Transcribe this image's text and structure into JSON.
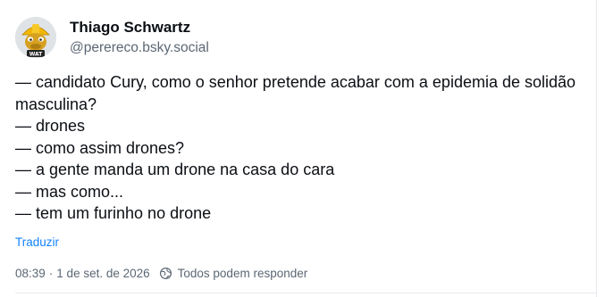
{
  "author": {
    "display_name": "Thiago Schwartz",
    "handle": "@perereco.bsky.social",
    "avatar_badge": "WAT"
  },
  "post": {
    "lines": [
      "— candidato Cury, como o senhor pretende acabar com a epidemia de solidão masculina?",
      "— drones",
      "— como assim drones?",
      "— a gente manda um drone na casa do cara",
      "— mas como...",
      "— tem um furinho no drone"
    ],
    "translate_label": "Traduzir"
  },
  "meta": {
    "time": "08:39",
    "separator": "·",
    "date": "1 de set. de 2026",
    "reply_setting": "Todos podem responder"
  },
  "colors": {
    "link": "#1083fe",
    "muted": "#5b6774",
    "text": "#0b0f14",
    "border": "#e6e9ee"
  }
}
